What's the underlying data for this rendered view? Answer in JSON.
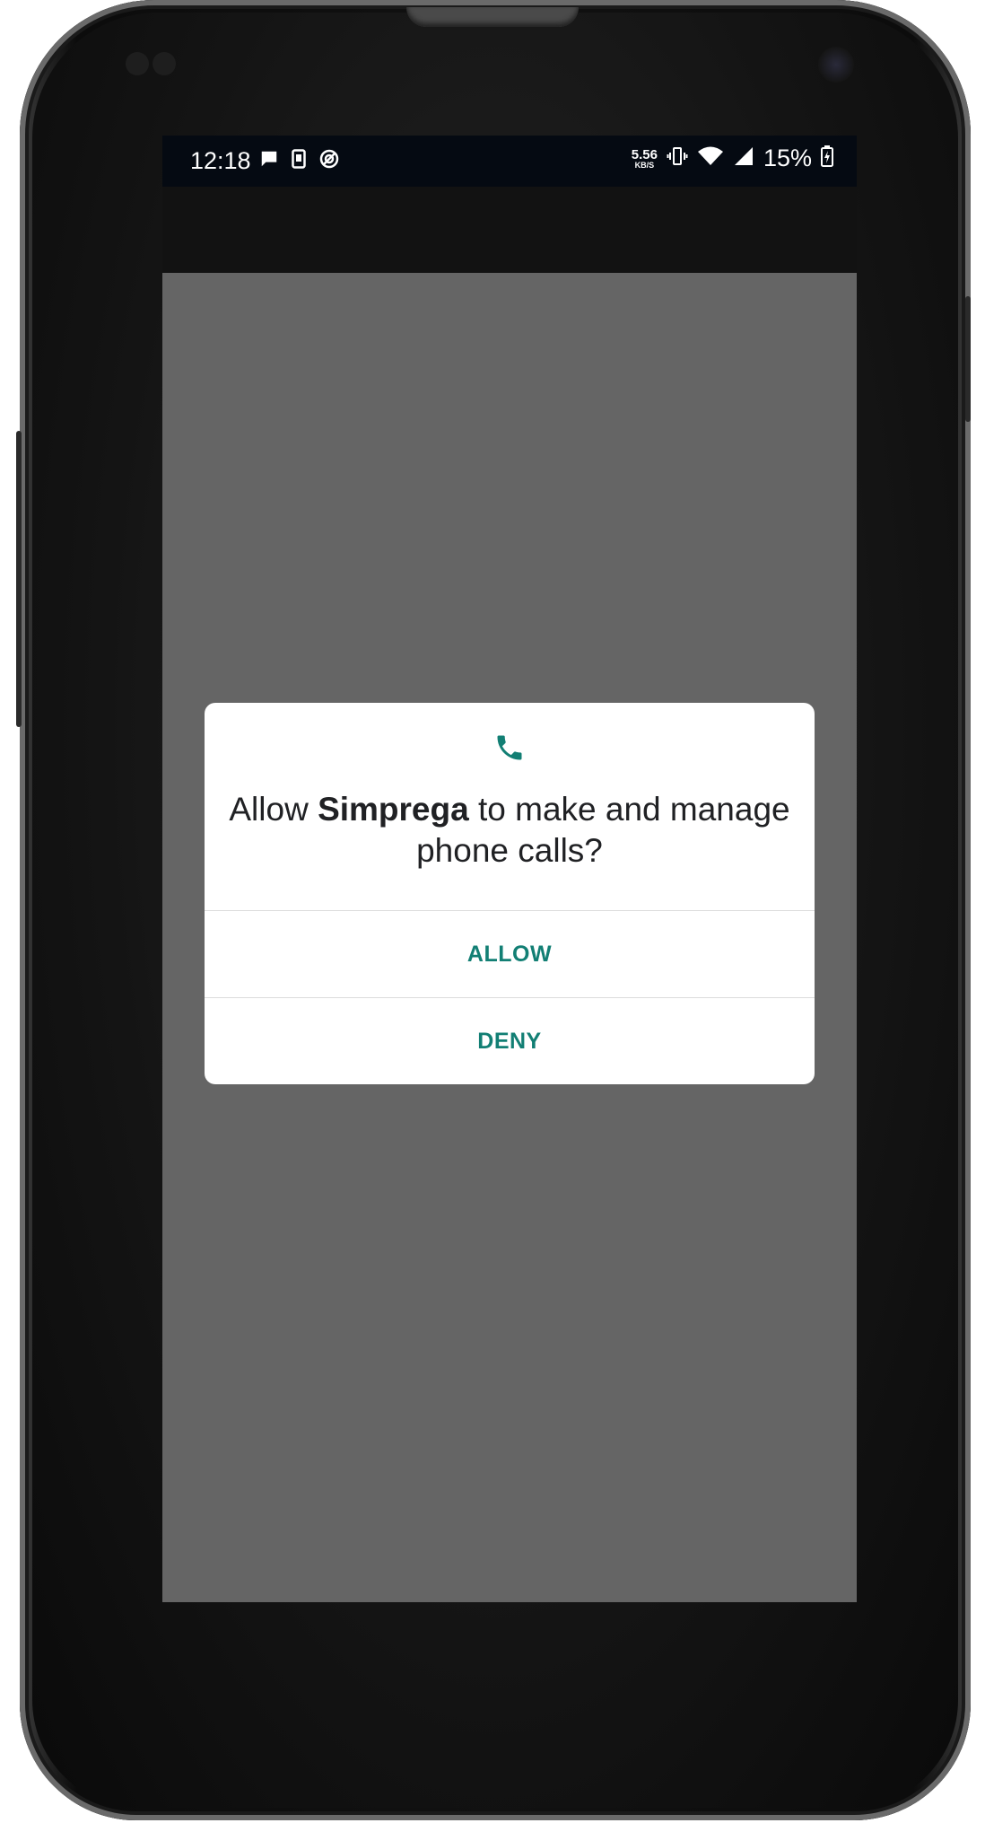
{
  "status_bar": {
    "time": "12:18",
    "net_speed_value": "5.56",
    "net_speed_unit": "KB/S",
    "battery_percent": "15%",
    "left_icons": [
      "message-icon",
      "sim-card-icon",
      "sync-icon"
    ],
    "right_icons": [
      "vibrate-icon",
      "wifi-icon",
      "cell-signal-icon",
      "battery-charging-icon"
    ]
  },
  "dialog": {
    "icon": "phone-icon",
    "title_prefix": "Allow ",
    "app_name": "Simprega",
    "title_suffix": " to make and manage phone calls?",
    "allow_label": "ALLOW",
    "deny_label": "DENY"
  },
  "colors": {
    "accent": "#127f74",
    "scrim": "#656565",
    "status_bar": "#050a12",
    "app_bar": "#121212",
    "dialog_bg": "#ffffff"
  }
}
